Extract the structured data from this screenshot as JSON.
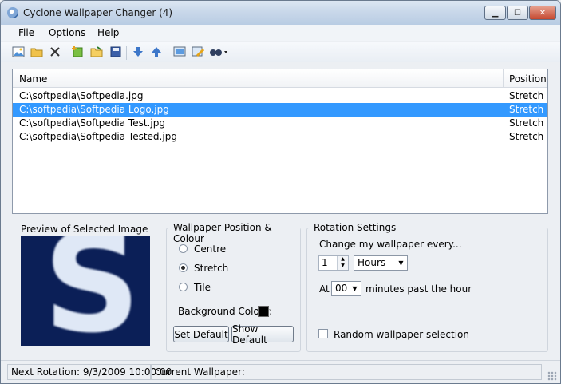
{
  "window": {
    "title": "Cyclone Wallpaper Changer (4)"
  },
  "menu": [
    "File",
    "Options",
    "Help"
  ],
  "toolbar_icons": [
    "image-icon",
    "open-folder-icon",
    "delete-icon",
    "add-image-icon",
    "open-file-icon",
    "save-icon",
    "move-down-icon",
    "move-up-icon",
    "set-wallpaper-icon",
    "edit-icon",
    "find-icon"
  ],
  "list": {
    "columns": [
      "Name",
      "Position"
    ],
    "rows": [
      {
        "name": "C:\\softpedia\\Softpedia.jpg",
        "position": "Stretch"
      },
      {
        "name": "C:\\softpedia\\Softpedia Logo.jpg",
        "position": "Stretch",
        "selected": true
      },
      {
        "name": "C:\\softpedia\\Softpedia Test.jpg",
        "position": "Stretch"
      },
      {
        "name": "C:\\softpedia\\Softpedia Tested.jpg",
        "position": "Stretch"
      }
    ]
  },
  "preview": {
    "label": "Preview of Selected Image",
    "letter": "S"
  },
  "position_group": {
    "label": "Wallpaper Position & Colour",
    "options": [
      "Centre",
      "Stretch",
      "Tile"
    ],
    "selected": "Stretch",
    "bg_label": "Background Colour:",
    "bg_color": "#000000",
    "set_default": "Set Default",
    "show_default": "Show Default"
  },
  "rotation": {
    "label": "Rotation Settings",
    "change_label": "Change my wallpaper every...",
    "interval_value": "1",
    "interval_unit": "Hours",
    "at_label": "At",
    "minute_value": "00",
    "minutes_label": "minutes past the hour",
    "random_label": "Random wallpaper selection"
  },
  "status": {
    "next_rotation": "Next Rotation: 9/3/2009 10:00:00",
    "current_wallpaper": "Current Wallpaper:"
  },
  "colors": {
    "selection": "#3399ff",
    "preview_bg": "#0b1f57"
  }
}
